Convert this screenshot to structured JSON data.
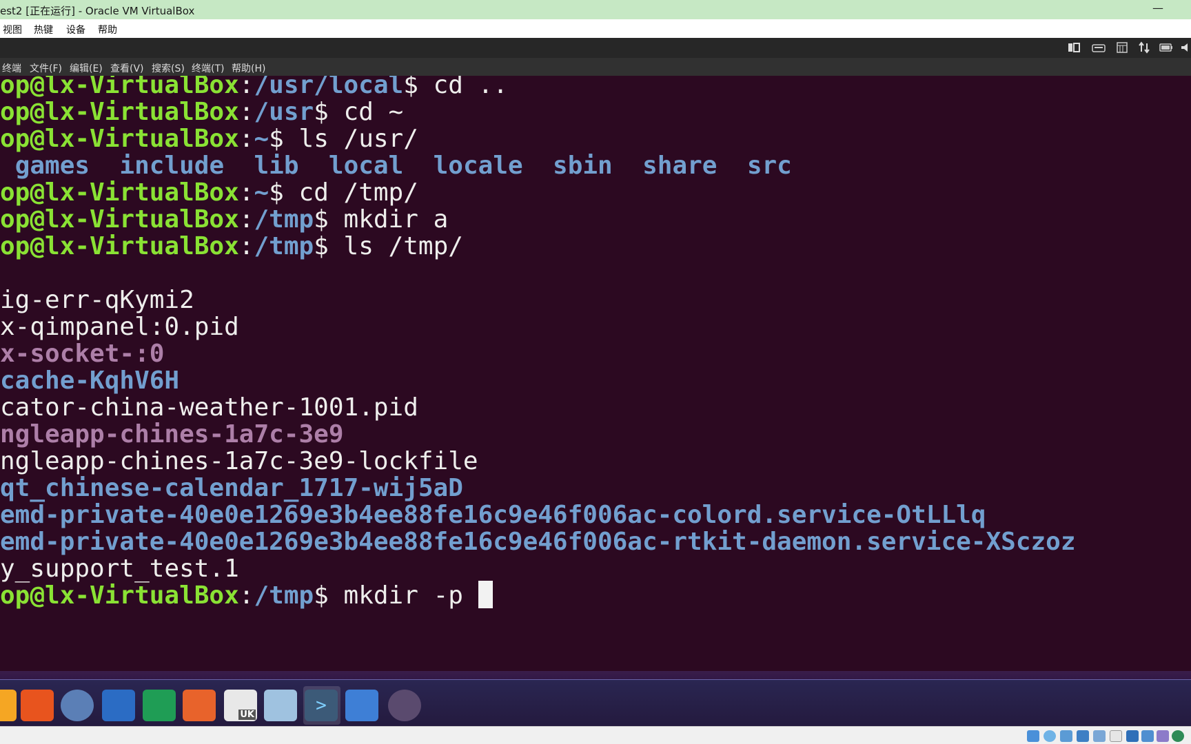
{
  "window": {
    "title": "est2 [正在运行] - Oracle VM VirtualBox",
    "minimize_glyph": "—"
  },
  "vbox_menu": [
    "视图",
    "热键",
    "设备",
    "帮助"
  ],
  "terminal_menu": [
    "终端",
    "文件(F)",
    "编辑(E)",
    "查看(V)",
    "搜索(S)",
    "终端(T)",
    "帮助(H)"
  ],
  "terminal": {
    "lines": [
      {
        "user": "op@lx-VirtualBox",
        "sep": ":",
        "path": "/usr/local",
        "prompt": "$ ",
        "cmd": "cd .."
      },
      {
        "user": "op@lx-VirtualBox",
        "sep": ":",
        "path": "/usr",
        "prompt": "$ ",
        "cmd": "cd ~"
      },
      {
        "user": "op@lx-VirtualBox",
        "sep": ":",
        "path": "~",
        "prompt": "$ ",
        "cmd": "ls /usr/"
      },
      {
        "dirs": [
          "games",
          "include",
          "lib",
          "local",
          "locale",
          "sbin",
          "share",
          "src"
        ]
      },
      {
        "user": "op@lx-VirtualBox",
        "sep": ":",
        "path": "~",
        "prompt": "$ ",
        "cmd": "cd /tmp/"
      },
      {
        "user": "op@lx-VirtualBox",
        "sep": ":",
        "path": "/tmp",
        "prompt": "$ ",
        "cmd": "mkdir a"
      },
      {
        "user": "op@lx-VirtualBox",
        "sep": ":",
        "path": "/tmp",
        "prompt": "$ ",
        "cmd": "ls /tmp/"
      },
      {
        "text": ""
      },
      {
        "text": "ig-err-qKymi2"
      },
      {
        "text": "x-qimpanel:0.pid"
      },
      {
        "text": "x-socket-:0",
        "kind": "socket"
      },
      {
        "text": "cache-KqhV6H",
        "kind": "dir"
      },
      {
        "text": "cator-china-weather-1001.pid"
      },
      {
        "text": "ngleapp-chines-1a7c-3e9",
        "kind": "socket"
      },
      {
        "text": "ngleapp-chines-1a7c-3e9-lockfile"
      },
      {
        "text": "qt_chinese-calendar_1717-wij5aD",
        "kind": "dir"
      },
      {
        "text": "emd-private-40e0e1269e3b4ee88fe16c9e46f006ac-colord.service-OtLLlq",
        "kind": "dir"
      },
      {
        "text": "emd-private-40e0e1269e3b4ee88fe16c9e46f006ac-rtkit-daemon.service-XSczoz",
        "kind": "dir"
      },
      {
        "text": "y_support_test.1"
      },
      {
        "user": "op@lx-VirtualBox",
        "sep": ":",
        "path": "/tmp",
        "prompt": "$ ",
        "cmd": "mkdir -p ",
        "cursor": true
      }
    ]
  },
  "dock": {
    "items": [
      {
        "name": "files-icon",
        "color": "#f5a623"
      },
      {
        "name": "firefox-icon",
        "color": "#e8541e"
      },
      {
        "name": "chromium-icon",
        "color": "#5b7fb6"
      },
      {
        "name": "wps-writer-icon",
        "color": "#2b6cc4"
      },
      {
        "name": "wps-spreadsheet-icon",
        "color": "#1f9d55"
      },
      {
        "name": "wps-presentation-icon",
        "color": "#e8632b"
      },
      {
        "name": "ubuntu-software-icon",
        "color": "#e8e8e8",
        "label": "UK"
      },
      {
        "name": "software-updater-icon",
        "color": "#9fc2e0"
      },
      {
        "name": "terminal-icon",
        "color": "#3c5a78",
        "active": true
      },
      {
        "name": "workspace-switcher-icon",
        "color": "#3e7fd6"
      },
      {
        "name": "dvd-icon",
        "color": "#5a4a6e"
      }
    ]
  }
}
